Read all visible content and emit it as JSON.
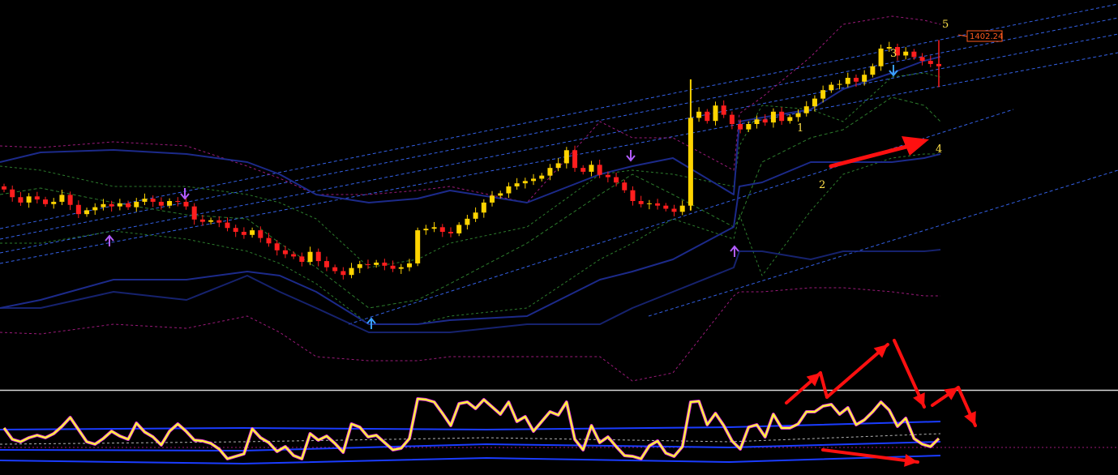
{
  "chart_data": {
    "type": "candlestick",
    "price_label": "1402.24",
    "wave_labels": [
      "1",
      "2",
      "3",
      "4",
      "5"
    ],
    "colors": {
      "background": "#000000",
      "up_candle": "#ffd400",
      "down_candle": "#ff1e1e",
      "channel_lines": "#3a6cff",
      "bollinger_outer": "#1c2a8a",
      "envelope_magenta": "#9b1a7a",
      "envelope_green": "#2d7d2d",
      "arrow_up": "#3aa0ff",
      "arrow_down": "#b25cff",
      "annotation_arrows": "#ff1010",
      "oscillator_line": "#ffff33",
      "oscillator_shadow": "#ff3cff",
      "oscillator_bands": "#1a3cff",
      "wave_labels": "#ffe14a",
      "price_tag": "#ff5a1e"
    },
    "price_close": [
      1382.5,
      1381.5,
      1380.8,
      1381.6,
      1381.2,
      1380.6,
      1380.9,
      1381.8,
      1380.5,
      1379.3,
      1379.8,
      1380.2,
      1380.6,
      1380.3,
      1380.7,
      1380.2,
      1380.9,
      1381.3,
      1380.9,
      1380.4,
      1381.0,
      1380.9,
      1380.3,
      1378.6,
      1378.3,
      1378.5,
      1378.2,
      1377.5,
      1377.0,
      1376.6,
      1377.2,
      1376.2,
      1375.5,
      1374.6,
      1374.1,
      1373.8,
      1373.1,
      1374.4,
      1373.2,
      1372.4,
      1371.9,
      1371.4,
      1372.3,
      1372.8,
      1372.7,
      1373.0,
      1372.6,
      1372.2,
      1372.4,
      1372.9,
      1377.2,
      1377.4,
      1377.6,
      1377.0,
      1376.8,
      1377.9,
      1378.7,
      1379.5,
      1380.8,
      1381.7,
      1382.0,
      1382.9,
      1383.3,
      1383.6,
      1383.9,
      1384.3,
      1385.3,
      1385.9,
      1387.6,
      1385.3,
      1384.8,
      1385.7,
      1384.4,
      1384.1,
      1383.4,
      1382.4,
      1381.0,
      1380.6,
      1380.7,
      1380.4,
      1380.0,
      1379.6,
      1380.4,
      1391.8,
      1392.6,
      1391.4,
      1393.4,
      1392.2,
      1391.0,
      1390.3,
      1391.0,
      1391.6,
      1391.2,
      1392.6,
      1391.4,
      1391.9,
      1392.4,
      1393.3,
      1394.3,
      1395.4,
      1396.1,
      1396.2,
      1397.0,
      1396.5,
      1397.4,
      1398.5,
      1400.8,
      1401.0,
      1399.9,
      1400.4,
      1399.7,
      1399.2,
      1398.8,
      1398.5
    ],
    "oscillator_values": [
      0.56,
      0.42,
      0.39,
      0.44,
      0.47,
      0.44,
      0.49,
      0.58,
      0.69,
      0.54,
      0.39,
      0.36,
      0.43,
      0.52,
      0.46,
      0.42,
      0.62,
      0.51,
      0.45,
      0.35,
      0.52,
      0.61,
      0.52,
      0.41,
      0.4,
      0.37,
      0.3,
      0.18,
      0.21,
      0.24,
      0.55,
      0.44,
      0.38,
      0.27,
      0.33,
      0.22,
      0.18,
      0.49,
      0.41,
      0.46,
      0.37,
      0.26,
      0.61,
      0.57,
      0.45,
      0.47,
      0.38,
      0.29,
      0.31,
      0.43,
      0.92,
      0.91,
      0.88,
      0.74,
      0.59,
      0.86,
      0.88,
      0.8,
      0.91,
      0.82,
      0.73,
      0.88,
      0.64,
      0.7,
      0.52,
      0.64,
      0.76,
      0.72,
      0.88,
      0.42,
      0.29,
      0.59,
      0.38,
      0.45,
      0.33,
      0.22,
      0.21,
      0.18,
      0.34,
      0.4,
      0.25,
      0.21,
      0.33,
      0.88,
      0.89,
      0.6,
      0.74,
      0.59,
      0.4,
      0.3,
      0.57,
      0.6,
      0.45,
      0.73,
      0.56,
      0.56,
      0.61,
      0.76,
      0.76,
      0.83,
      0.85,
      0.73,
      0.81,
      0.6,
      0.66,
      0.76,
      0.88,
      0.78,
      0.58,
      0.68,
      0.43,
      0.36,
      0.33,
      0.43
    ]
  }
}
